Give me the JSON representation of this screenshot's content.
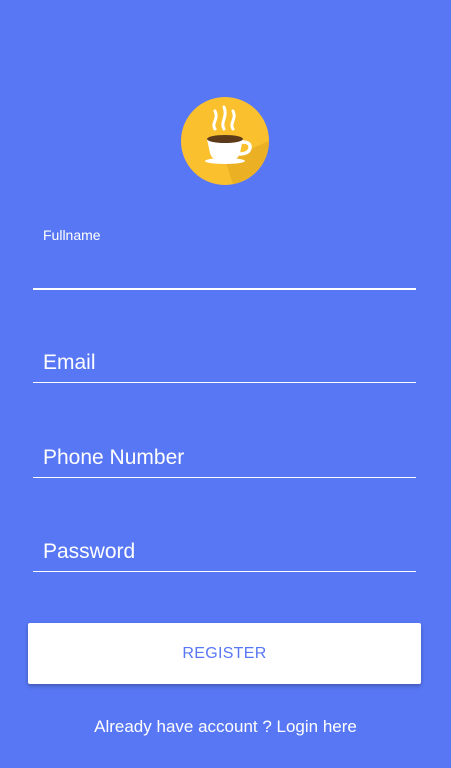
{
  "colors": {
    "background": "#5877f5",
    "logo_circle": "#fbc02d",
    "button_bg": "#ffffff",
    "button_text": "#5877f5",
    "field_text": "#ffffff"
  },
  "logo": {
    "icon": "coffee-cup-icon"
  },
  "form": {
    "fullname": {
      "label": "Fullname",
      "value": ""
    },
    "email": {
      "label": "Email",
      "value": ""
    },
    "phone": {
      "label": "Phone Number",
      "value": ""
    },
    "password": {
      "label": "Password",
      "value": ""
    }
  },
  "register_button": {
    "label": "REGISTER"
  },
  "login_link": {
    "text": "Already have account ? Login here"
  }
}
